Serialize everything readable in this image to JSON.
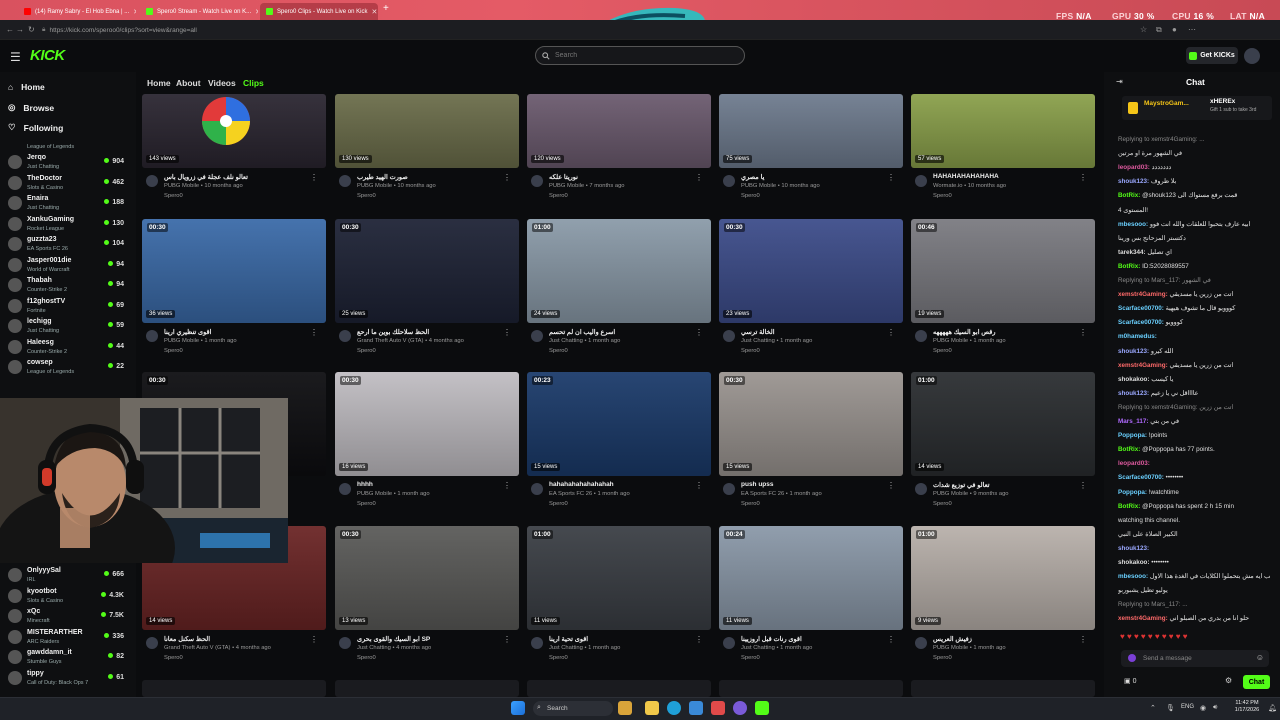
{
  "browser": {
    "tabs": [
      {
        "title": "(14) Ramy Sabry - El Hob Ebna | ...",
        "active": false,
        "color": "#ff0000"
      },
      {
        "title": "Spero0 Stream - Watch Live on K...",
        "active": false,
        "color": "#53fc18"
      },
      {
        "title": "Spero0 Clips - Watch Live on Kick",
        "active": true,
        "color": "#53fc18"
      }
    ],
    "url": "https://kick.com/speroo0/clips?sort=view&range=all",
    "overlay_stats": {
      "fps_label": "FPS",
      "fps": "N/A",
      "gpu_label": "GPU",
      "gpu": "30 %",
      "cpu_label": "CPU",
      "cpu": "16 %",
      "lat_label": "LAT",
      "lat": "N/A"
    }
  },
  "header": {
    "logo": "KICK",
    "search_placeholder": "Search",
    "get_kicks": "Get KICKs"
  },
  "sidebar": {
    "nav": [
      {
        "label": "Home",
        "icon": "home-icon"
      },
      {
        "label": "Browse",
        "icon": "compass-icon"
      },
      {
        "label": "Following",
        "icon": "heart-icon"
      }
    ],
    "top_category": "League of Legends",
    "channels": [
      {
        "name": "Jerqo",
        "category": "Just Chatting",
        "viewers": "904"
      },
      {
        "name": "TheDoctor",
        "category": "Slots & Casino",
        "viewers": "462"
      },
      {
        "name": "Enaira",
        "category": "Just Chatting",
        "viewers": "188"
      },
      {
        "name": "XankuGaming",
        "category": "Rocket League",
        "viewers": "130"
      },
      {
        "name": "guzzta23",
        "category": "EA Sports FC 26",
        "viewers": "104"
      },
      {
        "name": "Jasper001die",
        "category": "World of Warcraft",
        "viewers": "94"
      },
      {
        "name": "Thabah",
        "category": "Counter-Strike 2",
        "viewers": "94"
      },
      {
        "name": "f12ghostTV",
        "category": "Fortnite",
        "viewers": "69"
      },
      {
        "name": "lechigg",
        "category": "Just Chatting",
        "viewers": "59"
      },
      {
        "name": "Haleesg",
        "category": "Counter-Strike 2",
        "viewers": "44"
      },
      {
        "name": "cowsep",
        "category": "League of Legends",
        "viewers": "22"
      }
    ],
    "channels_bottom": [
      {
        "name": "OnlyyySal",
        "category": "IRL",
        "viewers": "666"
      },
      {
        "name": "kyootbot",
        "category": "Slots & Casino",
        "viewers": "4.3K"
      },
      {
        "name": "xQc",
        "category": "Minecraft",
        "viewers": "7.5K"
      },
      {
        "name": "MISTERARTHER",
        "category": "ARC Raiders",
        "viewers": "336"
      },
      {
        "name": "gawddamn_it",
        "category": "Stumble Guys",
        "viewers": "82"
      },
      {
        "name": "tippy",
        "category": "Call of Duty: Black Ops 7",
        "viewers": "61"
      }
    ]
  },
  "main": {
    "tabs": [
      "Home",
      "About",
      "Videos",
      "Clips"
    ],
    "clips": [
      {
        "duration": "",
        "views": "143 views",
        "title": "تعالو نلف عجلة في زرويال باس",
        "game": "PUBG Mobile",
        "ago": "10 months ago",
        "by": "Spero0",
        "bg": "#2a2530"
      },
      {
        "duration": "",
        "views": "130 views",
        "title": "صورت الهيد طيرب",
        "game": "PUBG Mobile",
        "ago": "10 months ago",
        "by": "Spero0",
        "bg": "#6b6d4a"
      },
      {
        "duration": "",
        "views": "120 views",
        "title": "نوريتا علكه",
        "game": "PUBG Mobile",
        "ago": "7 months ago",
        "by": "Spero0",
        "bg": "#6b5a6e"
      },
      {
        "duration": "",
        "views": "75 views",
        "title": "يا مصري",
        "game": "PUBG Mobile",
        "ago": "10 months ago",
        "by": "Spero0",
        "bg": "#6e7b8e"
      },
      {
        "duration": "",
        "views": "57 views",
        "title": "HAHAHAHAHAHAHA",
        "game": "Wormate.io",
        "ago": "10 months ago",
        "by": "Spero0",
        "bg": "#8aa04a"
      },
      {
        "duration": "00:30",
        "views": "36 views",
        "title": "اقوى تنظيري ارينا",
        "game": "PUBG Mobile",
        "ago": "1 month ago",
        "by": "Spero0",
        "bg": "#3a6aa8"
      },
      {
        "duration": "00:30",
        "views": "25 views",
        "title": "الحظ سلاحلك بوين ما ارحع",
        "game": "Grand Theft Auto V (GTA)",
        "ago": "4 months ago",
        "by": "Spero0",
        "bg": "#1d2235"
      },
      {
        "duration": "01:00",
        "views": "24 views",
        "title": "اسرع واليب ان لم تحسم",
        "game": "Just Chatting",
        "ago": "1 month ago",
        "by": "Spero0",
        "bg": "#8a9aa8"
      },
      {
        "duration": "00:30",
        "views": "23 views",
        "title": "الخالة ترسي",
        "game": "Just Chatting",
        "ago": "1 month ago",
        "by": "Spero0",
        "bg": "#3c4c8a"
      },
      {
        "duration": "00:46",
        "views": "19 views",
        "title": "رقص ابو السيك هههههه",
        "game": "PUBG Mobile",
        "ago": "1 month ago",
        "by": "Spero0",
        "bg": "#7a7a80"
      },
      {
        "duration": "00:30",
        "views": "",
        "title": "",
        "game": "",
        "ago": "",
        "by": "",
        "bg": "#0d0d10"
      },
      {
        "duration": "00:30",
        "views": "16 views",
        "title": "hhhh",
        "game": "PUBG Mobile",
        "ago": "1 month ago",
        "by": "Spero0",
        "bg": "#c0bdc2"
      },
      {
        "duration": "00:23",
        "views": "15 views",
        "title": "hahahahahahahahah",
        "game": "EA Sports FC 26",
        "ago": "1 month ago",
        "by": "Spero0",
        "bg": "#1a3a6a"
      },
      {
        "duration": "00:30",
        "views": "15 views",
        "title": "push upss",
        "game": "EA Sports FC 26",
        "ago": "1 month ago",
        "by": "Spero0",
        "bg": "#9a9490"
      },
      {
        "duration": "01:00",
        "views": "14 views",
        "title": "تعالو في توزيع شدات",
        "game": "PUBG Mobile",
        "ago": "9 months ago",
        "by": "Spero0",
        "bg": "#2a2d30"
      },
      {
        "duration": "",
        "views": "14 views",
        "title": "الحظ سكنل معانا",
        "game": "Grand Theft Auto V (GTA)",
        "ago": "4 months ago",
        "by": "Spero0",
        "bg": "#6a2424"
      },
      {
        "duration": "00:30",
        "views": "13 views",
        "title": "ابو السيك والقوى بحرى SP",
        "game": "Just Chatting",
        "ago": "4 months ago",
        "by": "Spero0",
        "bg": "#5a5a58"
      },
      {
        "duration": "01:00",
        "views": "11 views",
        "title": "اقوى تحية ارينا",
        "game": "Just Chatting",
        "ago": "1 month ago",
        "by": "Spero0",
        "bg": "#3a3e44"
      },
      {
        "duration": "00:24",
        "views": "11 views",
        "title": "اقوى رنات قبل اروزيينا",
        "game": "Just Chatting",
        "ago": "1 month ago",
        "by": "Spero0",
        "bg": "#8a98a8"
      },
      {
        "duration": "01:00",
        "views": "9 views",
        "title": "زفيش العريس",
        "game": "PUBG Mobile",
        "ago": "1 month ago",
        "by": "Spero0",
        "bg": "#b8b0aa"
      }
    ]
  },
  "chat": {
    "title": "Chat",
    "pinned": {
      "user": "MaystroGam...",
      "gift_user": "xHEREx",
      "gift_text": "Gift 1 sub to take 3rd"
    },
    "messages": [
      {
        "user": "",
        "text": "Replying to xemstr4Gaming: ...",
        "color": "#888"
      },
      {
        "user": "",
        "text": "في الشهور مرة او مرتين",
        "color": "#ddd"
      },
      {
        "user": "leopard03:",
        "text": "ددددددد",
        "color": "#e05aa0"
      },
      {
        "user": "shouk123:",
        "text": "بلا ظروف",
        "color": "#9aa8ff"
      },
      {
        "user": "BotRix:",
        "text": "@shouk123 قمت برفع مستواك الى",
        "color": "#53fc18"
      },
      {
        "user": "",
        "text": "المستوى 4!",
        "color": "#ddd"
      },
      {
        "user": "mbesooo:",
        "text": "ابيه عارف بتحبوا للعلقات والله انت فوو",
        "color": "#6ad0ff"
      },
      {
        "user": "",
        "text": "دكتستر المزحانج بس ورينا",
        "color": "#ddd"
      },
      {
        "user": "tarek344:",
        "text": "اي تصليل",
        "color": "#ddd"
      },
      {
        "user": "BotRix:",
        "text": "ID:52028089557",
        "color": "#53fc18"
      },
      {
        "user": "",
        "text": "Replying to Mars_117: في الشهور",
        "color": "#888"
      },
      {
        "user": "xemstr4Gaming:",
        "text": "اتت من زرين يا مسديقي",
        "color": "#ff6a6a"
      },
      {
        "user": "Scarface00700:",
        "text": "كووويو قال ما تشوف هيهية",
        "color": "#6ad0ff"
      },
      {
        "user": "Scarface00700:",
        "text": "كووويو",
        "color": "#6ad0ff"
      },
      {
        "user": "m0hamedus:",
        "text": "",
        "color": "#6ad0ff"
      },
      {
        "user": "shouk123:",
        "text": "الله كيرو",
        "color": "#9aa8ff"
      },
      {
        "user": "xemstr4Gaming:",
        "text": "اتت من زرين يا مسديقي",
        "color": "#ff6a6a"
      },
      {
        "user": "shokakoo:",
        "text": "يا كيسب",
        "color": "#ddd"
      },
      {
        "user": "shouk123:",
        "text": "عااااقل ني يا زعيم",
        "color": "#9aa8ff"
      },
      {
        "user": "",
        "text": "Replying to xemstr4Gaming: اتت من زرين",
        "color": "#888"
      },
      {
        "user": "Mars_117:",
        "text": "في من بتي",
        "color": "#b06aff"
      },
      {
        "user": "Poppopa:",
        "text": "!points",
        "color": "#6ad0ff"
      },
      {
        "user": "BotRix:",
        "text": "@Poppopa has 77 points.",
        "color": "#53fc18"
      },
      {
        "user": "leopard03:",
        "text": "",
        "color": "#e05aa0"
      },
      {
        "user": "Scarface00700:",
        "text": "••••••••",
        "color": "#6ad0ff"
      },
      {
        "user": "Poppopa:",
        "text": "!watchtime",
        "color": "#6ad0ff"
      },
      {
        "user": "BotRix:",
        "text": "@Poppopa has spent 2 h 15 min",
        "color": "#53fc18"
      },
      {
        "user": "",
        "text": "watching this channel.",
        "color": "#ddd"
      },
      {
        "user": "",
        "text": "الكبير الصلاة على النبي",
        "color": "#ddd"
      },
      {
        "user": "shouk123:",
        "text": "",
        "color": "#9aa8ff"
      },
      {
        "user": "shokakoo:",
        "text": "••••••••",
        "color": "#ddd"
      },
      {
        "user": "mbesooo:",
        "text": "طلب ايه مش بتحملوا الكلايات في الغدة هذا الاول",
        "color": "#6ad0ff"
      },
      {
        "user": "",
        "text": "يوليو تظيل يشبوربو",
        "color": "#ddd"
      },
      {
        "user": "",
        "text": "Replying to Mars_117: ...",
        "color": "#888"
      },
      {
        "user": "xemstr4Gaming:",
        "text": "حلو انا من بدري من الصبلو اني",
        "color": "#ff6a6a"
      }
    ],
    "input_placeholder": "Send a message",
    "send_label": "Chat",
    "viewer_count": "0"
  },
  "taskbar": {
    "search": "Search",
    "lang": "ENG",
    "time": "11:42 PM",
    "date": "1/17/2026"
  }
}
